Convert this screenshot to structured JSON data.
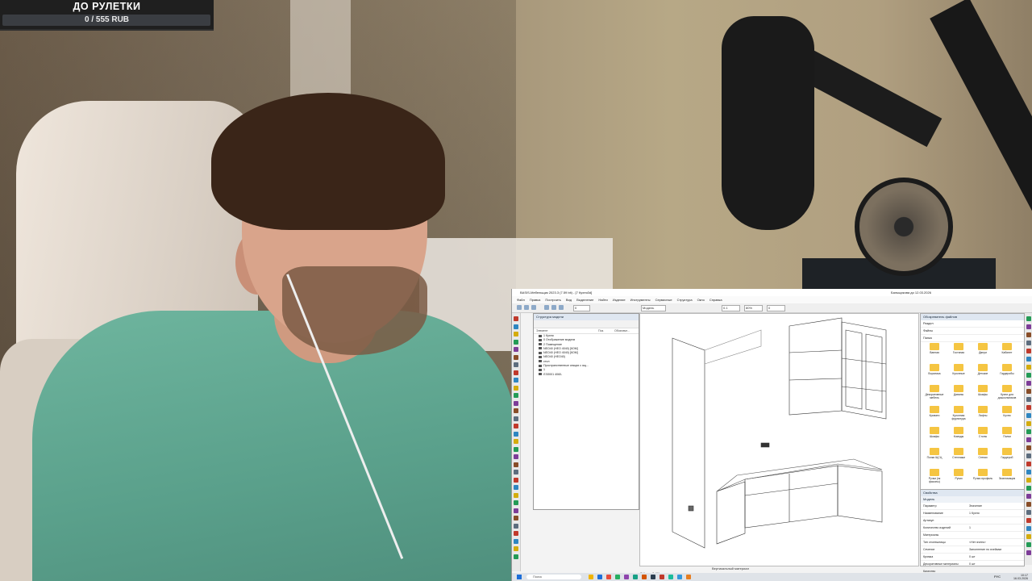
{
  "donation_widget": {
    "title": "ДО РУЛЕТКИ",
    "value_text": "0 / 555 RUB",
    "progress_fraction": 0,
    "bar_color": "#7a9bc2"
  },
  "screen": {
    "window_title": "BASIS-Мебельщик 2023.3 (7.59 bit) - [7 Кухня3d]",
    "account": "Бальщикова до 12.03.2026",
    "menu": [
      "Файл",
      "Правка",
      "Построить",
      "Вид",
      "Выделение",
      "Найти",
      "Изделие",
      "Инструменты",
      "Сервисные",
      "Структура",
      "Окно",
      "Справка"
    ],
    "structure_panel": {
      "title": "Структура модели",
      "columns": [
        "Элемент",
        "Поз.",
        "Обозначе..."
      ],
      "rows": [
        "1 Кухня",
        "0 Отображение модели",
        "2 Помещение",
        "NEO40 (НЕО 4040) [КОМ]",
        "NEO40 (НЕО 4040) [КОМ]",
        "NEO40 (НЕО40)",
        "стол",
        "Пространственные секции с ящ...",
        "1",
        "ЛЭЗ001 4060-"
      ]
    },
    "file_panel": {
      "title": "Обозреватель файлов",
      "rows": [
        "Раздел",
        "Файлы",
        "Папка"
      ],
      "folders": [
        "Ванная",
        "Гостиная",
        "Двери",
        "Кабинет",
        "Вороника",
        "Кухонные",
        "Детские",
        "Гардеробы",
        "Декоративные мебель",
        "Диваны",
        "Шкафы",
        "Кухни для дошкольников",
        "Кровати",
        "Кухонная фурнитура",
        "Лифты",
        "Кухни",
        "Шкафы",
        "Комоды",
        "Столы",
        "Полки",
        "Полки ЩСЦ",
        "Стеллажи",
        "Стенки",
        "Гардероб",
        "Ручки (пк фасоны)",
        "Ручки",
        "Ручки-профиль",
        "Экспликация"
      ]
    },
    "properties_panel": {
      "title": "Свойства",
      "section": "Модель",
      "rows": [
        {
          "k": "Параметр",
          "v": "Значение"
        },
        {
          "k": "Наименование",
          "v": "1 Кухня"
        },
        {
          "k": "Артикул",
          "v": ""
        },
        {
          "k": "Количество изделий",
          "v": "1"
        },
        {
          "k": "Материалы",
          "v": ""
        },
        {
          "k": "Тип столешницы",
          "v": "<Нет ячеек>"
        },
        {
          "k": "Сечение",
          "v": "Заполнение по ячейкам"
        },
        {
          "k": "Кромка",
          "v": "0 шт"
        },
        {
          "k": "Декоративные материалы",
          "v": "0 шт"
        },
        {
          "k": "Качество",
          "v": ""
        }
      ]
    },
    "viewport_tab": "7 Кухня 3d(1)",
    "status_text": "Вертикальный материал",
    "taskbar": {
      "search_placeholder": "Поиск",
      "time": "10:17",
      "date": "16.03.2026",
      "lang": "РУС"
    },
    "toolbar_fields": {
      "layer": "0",
      "model": "Модель",
      "f1": "0",
      "f2": "0.1",
      "f3": "80%",
      "f4": "0"
    }
  }
}
